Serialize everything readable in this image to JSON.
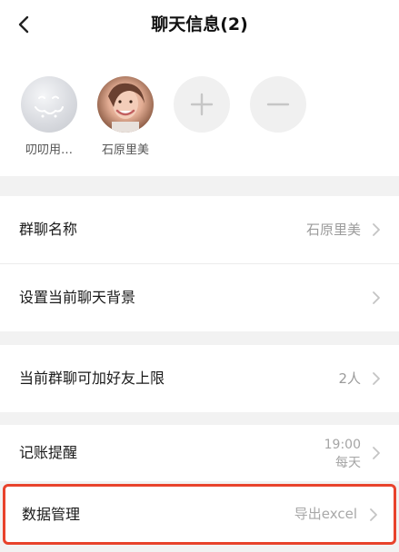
{
  "header": {
    "title": "聊天信息(2)",
    "back_icon": "chevron-left-icon"
  },
  "members": [
    {
      "name": "叨叨用…",
      "avatar": "cloud-avatar"
    },
    {
      "name": "石原里美",
      "avatar": "photo-avatar"
    }
  ],
  "member_actions": {
    "add_icon": "plus-icon",
    "remove_icon": "minus-icon"
  },
  "settings": {
    "group_name": {
      "label": "群聊名称",
      "value": "石原里美"
    },
    "background": {
      "label": "设置当前聊天背景"
    },
    "friend_limit": {
      "label": "当前群聊可加好友上限",
      "value": "2人"
    },
    "reminder": {
      "label": "记账提醒",
      "time": "19:00",
      "frequency": "每天"
    },
    "data_management": {
      "label": "数据管理",
      "value": "导出excel"
    }
  },
  "colors": {
    "highlight_border": "#e8432c",
    "secondary_text": "#9b9b9b",
    "background": "#f2f2f2"
  }
}
